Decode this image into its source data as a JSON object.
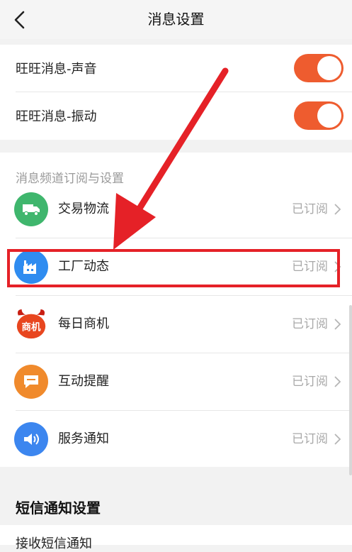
{
  "header": {
    "title": "消息设置"
  },
  "wangwang": {
    "sound_label": "旺旺消息-声音",
    "vibrate_label": "旺旺消息-振动",
    "sound_on": true,
    "vibrate_on": true
  },
  "channels": {
    "section_title": "消息频道订阅与设置",
    "items": [
      {
        "name": "交易物流",
        "status": "已订阅",
        "icon": "truck-icon",
        "color": "#3fb66d"
      },
      {
        "name": "工厂动态",
        "status": "已订阅",
        "icon": "factory-icon",
        "color": "#2f8cf0"
      },
      {
        "name": "每日商机",
        "status": "已订阅",
        "icon": "business-opportunity-icon",
        "color": "#e8461f",
        "icon_text": "商机"
      },
      {
        "name": "互动提醒",
        "status": "已订阅",
        "icon": "chat-icon",
        "color": "#f08a2c"
      },
      {
        "name": "服务通知",
        "status": "已订阅",
        "icon": "speaker-icon",
        "color": "#3c86ef"
      }
    ]
  },
  "sms": {
    "section_title": "短信通知设置",
    "receive_label": "接收短信通知"
  },
  "colors": {
    "accent": "#ee5c2f",
    "highlight": "#e52127"
  }
}
